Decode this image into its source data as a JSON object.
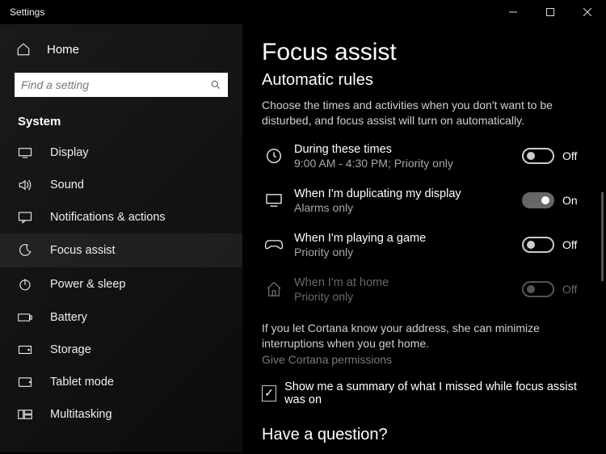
{
  "window": {
    "title": "Settings"
  },
  "sidebar": {
    "home": "Home",
    "search_placeholder": "Find a setting",
    "section": "System",
    "items": [
      {
        "label": "Display"
      },
      {
        "label": "Sound"
      },
      {
        "label": "Notifications & actions"
      },
      {
        "label": "Focus assist"
      },
      {
        "label": "Power & sleep"
      },
      {
        "label": "Battery"
      },
      {
        "label": "Storage"
      },
      {
        "label": "Tablet mode"
      },
      {
        "label": "Multitasking"
      }
    ]
  },
  "main": {
    "title": "Focus assist",
    "section": "Automatic rules",
    "description": "Choose the times and activities when you don't want to be disturbed, and focus assist will turn on automatically.",
    "rules": [
      {
        "title": "During these times",
        "subtitle": "9:00 AM - 4:30 PM; Priority only",
        "state": "Off"
      },
      {
        "title": "When I'm duplicating my display",
        "subtitle": "Alarms only",
        "state": "On"
      },
      {
        "title": "When I'm playing a game",
        "subtitle": "Priority only",
        "state": "Off"
      },
      {
        "title": "When I'm at home",
        "subtitle": "Priority only",
        "state": "Off"
      }
    ],
    "cortana_hint": "If you let Cortana know your address, she can minimize interruptions when you get home.",
    "cortana_link": "Give Cortana permissions",
    "summary_checkbox": "Show me a summary of what I missed while focus assist was on",
    "question": "Have a question?"
  }
}
